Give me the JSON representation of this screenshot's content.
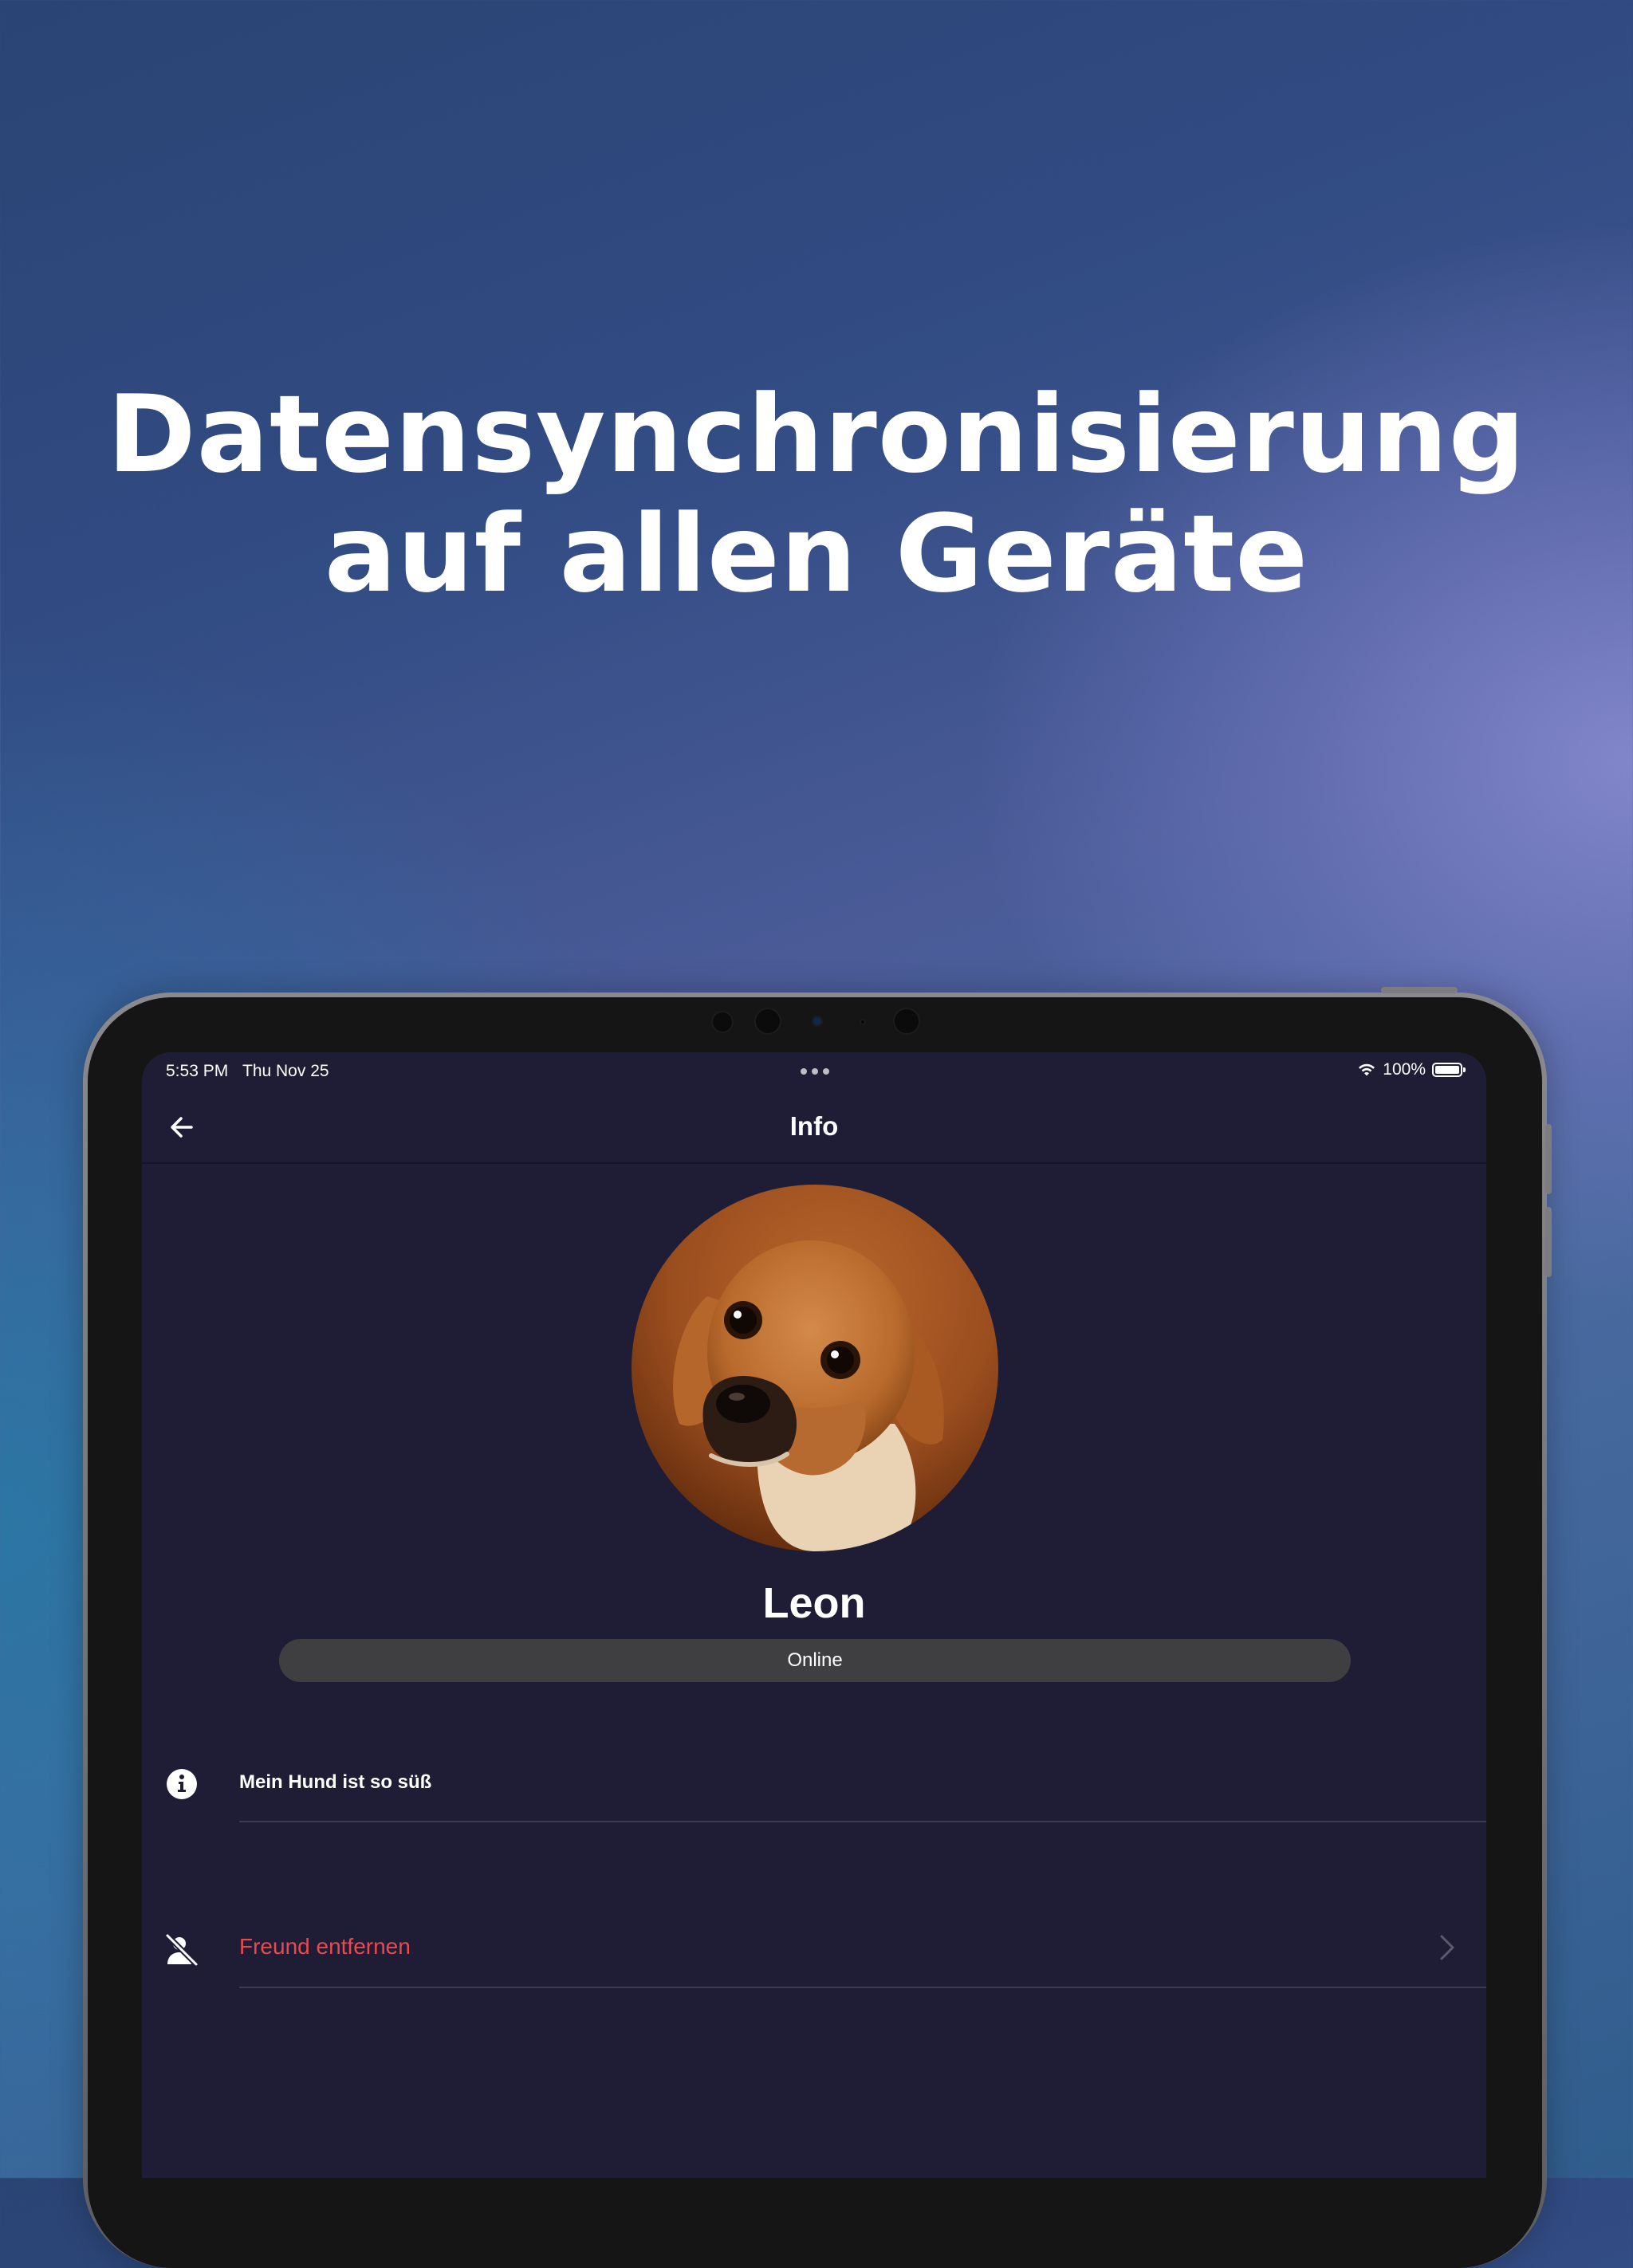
{
  "headline": {
    "line1": "Datensynchronisierung",
    "line2": "auf allen Geräte"
  },
  "status_bar": {
    "time": "5:53 PM",
    "date": "Thu Nov 25",
    "battery": "100%"
  },
  "nav": {
    "title": "Info"
  },
  "profile": {
    "name": "Leon",
    "status": "Online"
  },
  "rows": {
    "about": {
      "label": "Mein Hund ist so süß",
      "icon": "info-icon"
    },
    "remove_friend": {
      "label": "Freund entfernen",
      "icon": "remove-person-icon"
    }
  },
  "colors": {
    "screen_background": "#1e1d35",
    "danger_text": "#e84a4f",
    "status_pill": "#3f3f41"
  }
}
